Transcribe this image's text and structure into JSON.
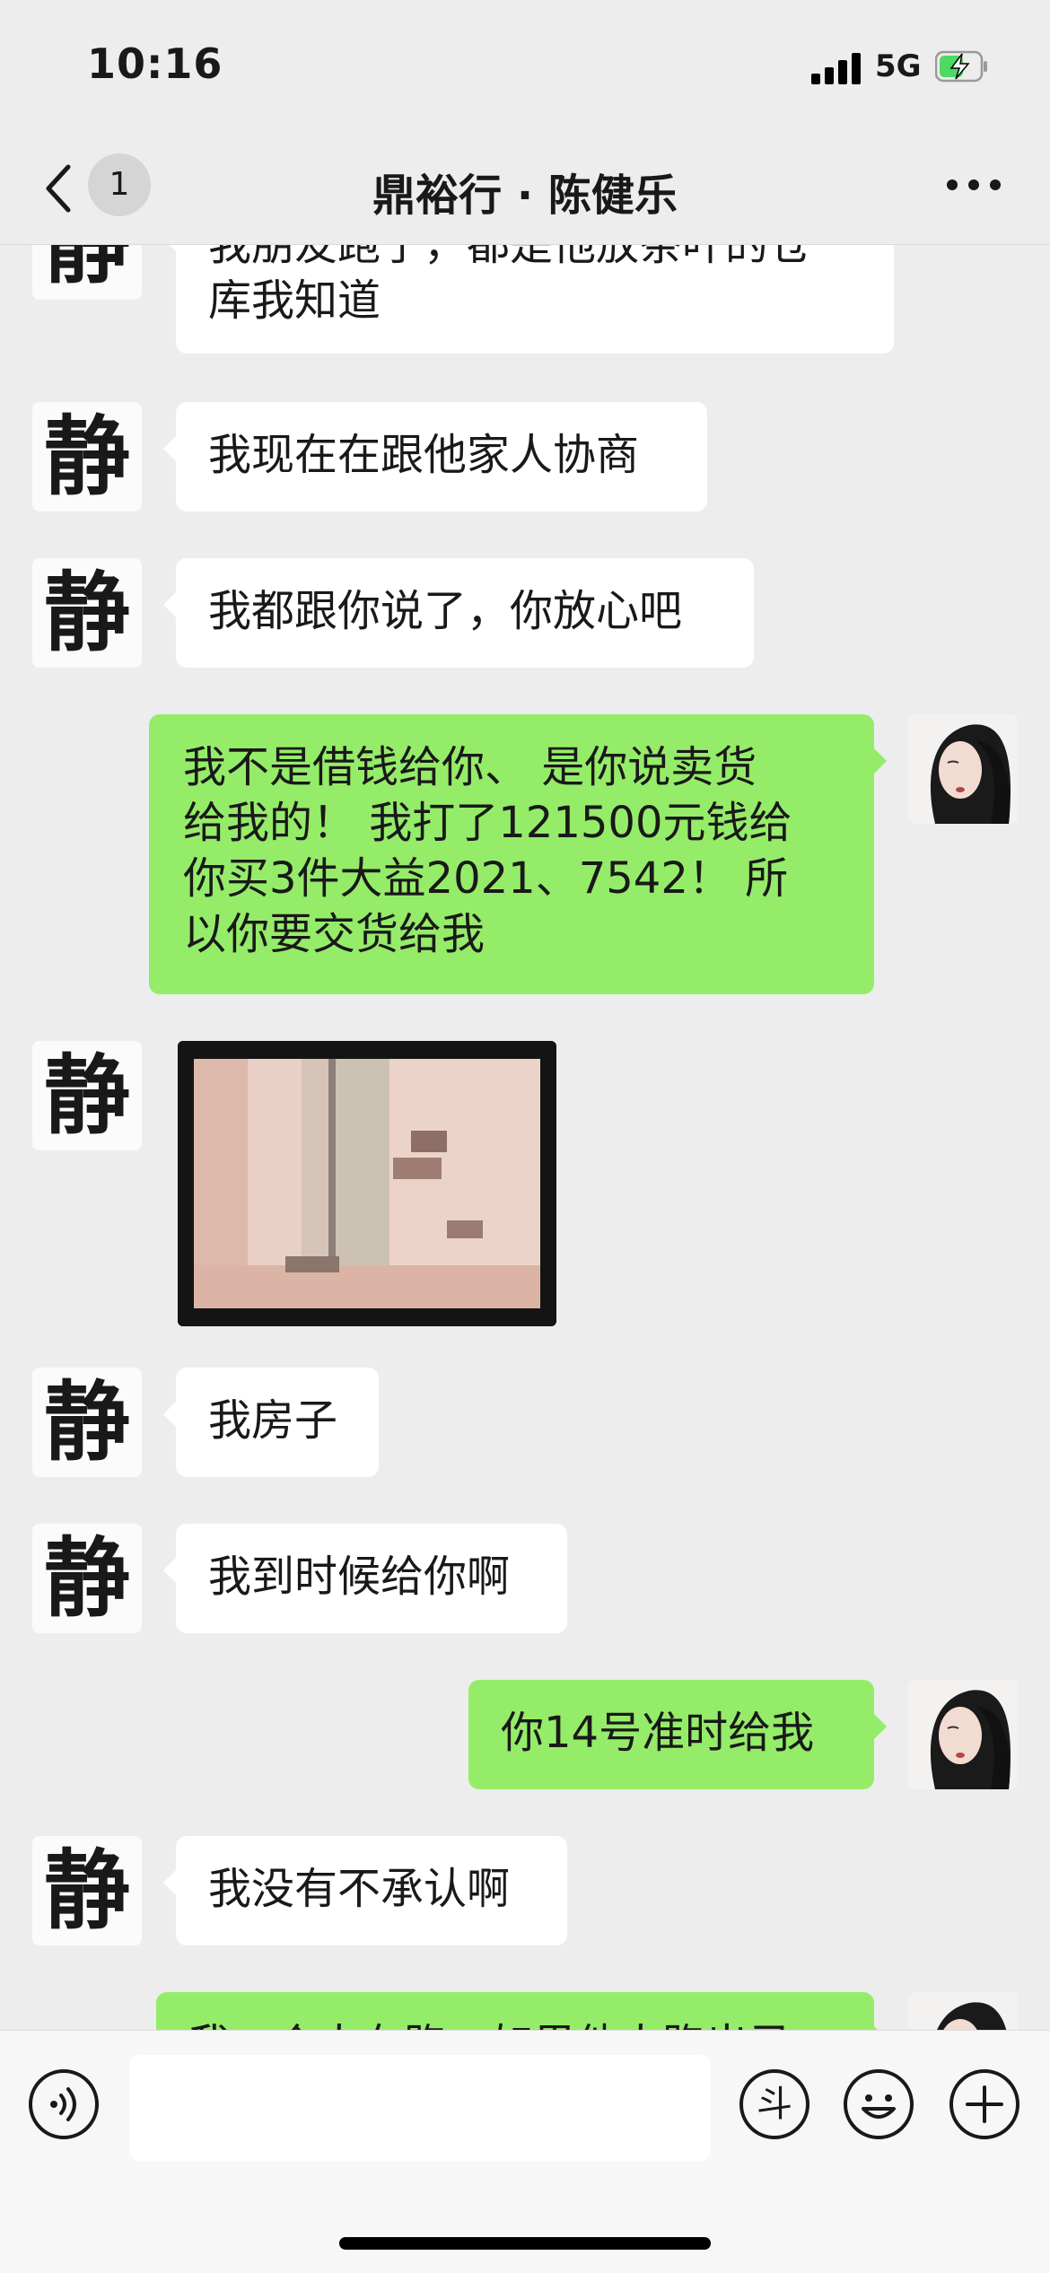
{
  "status_bar": {
    "time": "10:16",
    "network": "5G",
    "battery_icon": "battery-charging-icon",
    "signal_icon": "cellular-signal-icon"
  },
  "header": {
    "back_icon": "chevron-left-icon",
    "unread_count": "1",
    "title": "鼎裕行 · 陈健乐",
    "more_icon": "ellipsis-icon"
  },
  "messages": [
    {
      "side": "in",
      "lines": [
        "我朋友跑了，都是他放茶叶的仓",
        "库我知道"
      ]
    },
    {
      "side": "in",
      "lines": [
        "我现在在跟他家人协商"
      ]
    },
    {
      "side": "in",
      "lines": [
        "我都跟你说了，你放心吧"
      ]
    },
    {
      "side": "out",
      "lines": [
        "我不是借钱给你、  是你说卖货",
        "给我的！  我打了121500元钱给",
        "你买3件大益2021、7542！  所",
        "以你要交货给我"
      ]
    },
    {
      "side": "in",
      "type": "image",
      "image_icon": "pixelated-photo"
    },
    {
      "side": "in",
      "lines": [
        "我房子"
      ]
    },
    {
      "side": "in",
      "lines": [
        "我到时候给你啊"
      ]
    },
    {
      "side": "out",
      "lines": [
        "你14号准时给我"
      ]
    },
    {
      "side": "in",
      "lines": [
        "我没有不承认啊"
      ]
    },
    {
      "side": "out",
      "lines": [
        "我一个人在跑，如果他人跑出录"
      ]
    }
  ],
  "avatars": {
    "contact": "calligraphy-jing-avatar",
    "self": "woman-portrait-avatar",
    "contact_glyph": "静"
  },
  "input_bar": {
    "voice_icon": "voice-icon",
    "sticker_icon": "douyin-sticker-icon",
    "sticker_glyph": "斗",
    "emoji_icon": "emoji-icon",
    "plus_icon": "plus-icon",
    "input_value": ""
  },
  "colors": {
    "background": "#ededed",
    "incoming_bubble": "#ffffff",
    "outgoing_bubble": "#95ec69",
    "battery_charge": "#4cd964"
  }
}
